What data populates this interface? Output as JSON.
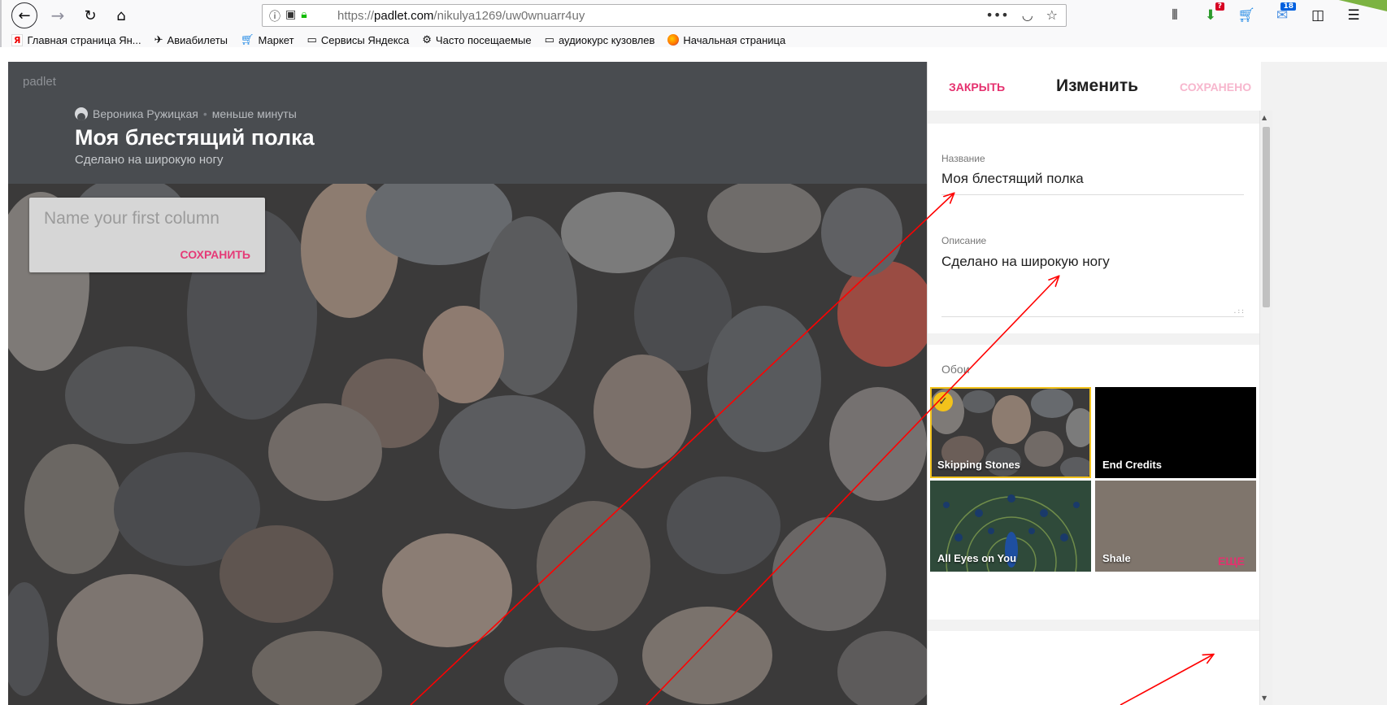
{
  "browser": {
    "url_prefix": "https://",
    "url_host": "padlet.com",
    "url_path": "/nikulya1269/uw0wnuarr4uy",
    "badges": {
      "downloads": "?",
      "mail": "18"
    }
  },
  "bookmarks": [
    {
      "label": "Главная страница Ян...",
      "icon": "yandex-icon"
    },
    {
      "label": "Авиабилеты",
      "icon": "plane-icon"
    },
    {
      "label": "Маркет",
      "icon": "cart-icon"
    },
    {
      "label": "Сервисы Яндекса",
      "icon": "folder-icon"
    },
    {
      "label": "Часто посещаемые",
      "icon": "gear-icon"
    },
    {
      "label": "аудиокурс кузовлев",
      "icon": "folder-icon"
    },
    {
      "label": "Начальная страница",
      "icon": "firefox-icon"
    }
  ],
  "board": {
    "logo": "padlet",
    "author": "Вероника Ружицкая",
    "time": "меньше минуты",
    "title": "Моя блестящий полка",
    "description": "Сделано на широкую ногу"
  },
  "column": {
    "placeholder": "Name your first column",
    "save_label": "СОХРАНИТЬ"
  },
  "panel": {
    "close_label": "ЗАКРЫТЬ",
    "title": "Изменить",
    "saved_label": "СОХРАНЕНО",
    "name_label": "Название",
    "name_value": "Моя блестящий полка",
    "desc_label": "Описание",
    "desc_value": "Сделано на широкую ногу",
    "wallpaper_label": "Обои",
    "wallpapers": [
      {
        "name": "Skipping Stones",
        "selected": true
      },
      {
        "name": "End Credits",
        "selected": false
      },
      {
        "name": "All Eyes on You",
        "selected": false
      },
      {
        "name": "Shale",
        "selected": false
      }
    ],
    "more_label": "ЕЩЕ"
  },
  "colors": {
    "accent": "#e5306e",
    "header_bg": "#494c50",
    "selected_outline": "#f2c21b",
    "annotation_arrow": "#ff0000"
  }
}
